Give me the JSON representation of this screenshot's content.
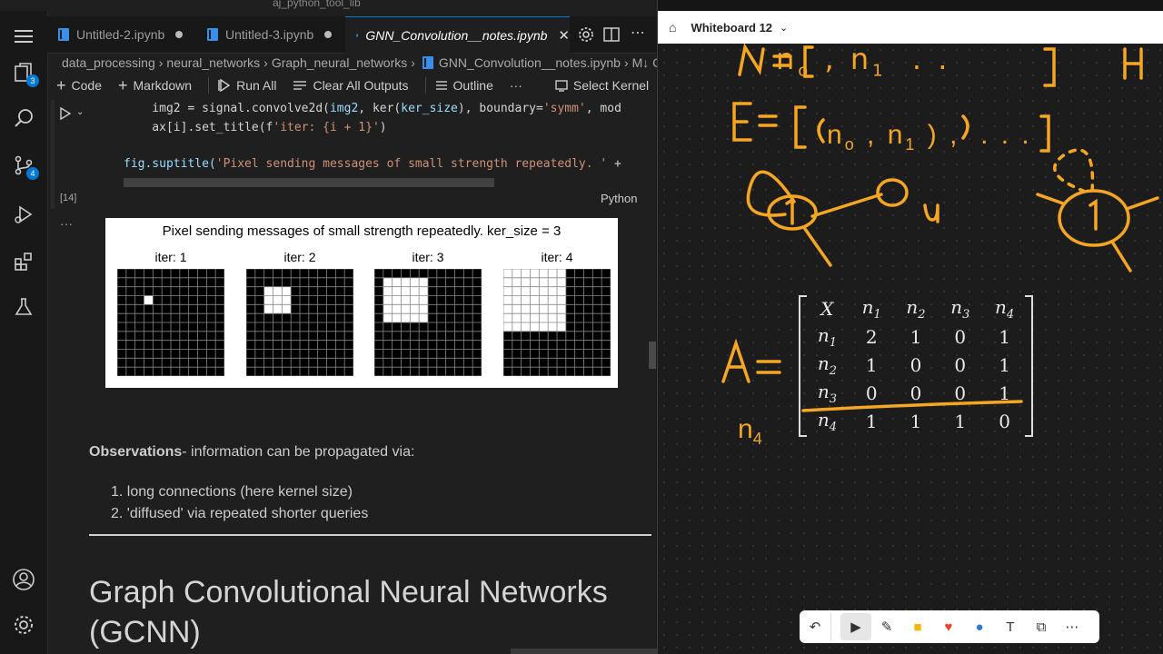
{
  "titlebar": {
    "search_text": "aj_python_tool_lib"
  },
  "tabs": [
    {
      "label": "Untitled-2.ipynb"
    },
    {
      "label": "Untitled-3.ipynb"
    },
    {
      "label": "GNN_Convolution__notes.ipynb"
    }
  ],
  "breadcrumb": [
    "data_processing",
    "neural_networks",
    "Graph_neural_networks",
    "GNN_Convolution__notes.ipynb",
    "M↓ C"
  ],
  "toolbar": {
    "code": "Code",
    "markdown": "Markdown",
    "run_all": "Run All",
    "clear_outputs": "Clear All Outputs",
    "outline": "Outline",
    "more": "···",
    "select_kernel": "Select Kernel"
  },
  "activity_badges": {
    "explorer": "3",
    "scm": "4"
  },
  "cell": {
    "line1_a": "    img2 = signal.convolve2d(",
    "line1_b": "img2",
    "line1_c": ", ker(",
    "line1_d": "ker_size",
    "line1_e": "), boundary=",
    "line1_f": "'symm'",
    "line1_g": ", mod",
    "line2_a": "    ax[i].set_title(f",
    "line2_b": "'iter: {i + 1}'",
    "line2_c": ")",
    "line3_a": "fig.suptitle(",
    "line3_b": "'Pixel sending messages of small strength repeatedly. '",
    "line3_c": " +",
    "exec_count": "[14]",
    "language": "Python"
  },
  "output": {
    "suptitle": "Pixel sending messages of small strength repeatedly. ker_size = 3",
    "panels": [
      {
        "title": "iter: 1",
        "white_size": 1
      },
      {
        "title": "iter: 2",
        "white_size": 3
      },
      {
        "title": "iter: 3",
        "white_size": 5
      },
      {
        "title": "iter: 4",
        "white_size": 7
      }
    ]
  },
  "markdown": {
    "obs_bold": "Observations",
    "obs_rest": "- information can be propagated via:",
    "items": [
      "long connections (here kernel size)",
      "'diffused' via repeated shorter queries"
    ],
    "heading_line1": "Graph Convolutional Neural Networks",
    "heading_line2": "(GCNN)"
  },
  "whiteboard": {
    "title": "Whiteboard 12",
    "ink_color": "#f5a623",
    "handwriting": {
      "N": "N = [ n₀ , n₁ . . . ]",
      "H": "H",
      "E": "E = [ ( n₀ , n₁ ) , . . . ]",
      "node1": "1",
      "node_u": "u",
      "node1b": "1",
      "A": "A =",
      "n4": "n₄"
    },
    "matrix": {
      "header": [
        "X",
        "n1",
        "n2",
        "n3",
        "n4"
      ],
      "rows": [
        [
          "n1",
          "2",
          "1",
          "0",
          "1"
        ],
        [
          "n2",
          "1",
          "0",
          "0",
          "1"
        ],
        [
          "n3",
          "0",
          "0",
          "0",
          "1"
        ],
        [
          "n4",
          "1",
          "1",
          "1",
          "0"
        ]
      ]
    }
  }
}
